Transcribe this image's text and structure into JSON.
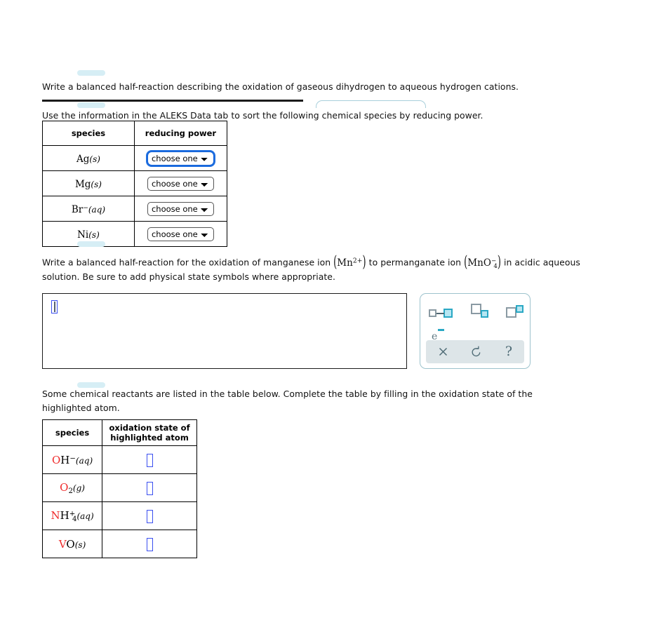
{
  "page": {
    "background": "#ffffff",
    "focus_ring_color": "#1f6fe0",
    "highlight_atom_color": "#ef2b2b",
    "input_box_color": "#3a4ff0",
    "palette_accent": "#2aa8c4"
  },
  "question_1": {
    "text": "Write a balanced half-reaction describing the oxidation of gaseous dihydrogen to aqueous hydrogen cations."
  },
  "question_2": {
    "text": "Use the information in the ALEKS Data tab to sort the following chemical species by reducing power.",
    "table": {
      "headers": [
        "species",
        "reducing power"
      ],
      "rows": [
        {
          "species": {
            "symbol": "Ag",
            "charge": "",
            "state": "(s)"
          },
          "select": {
            "value": "choose one",
            "options": [
              "choose one"
            ],
            "focused": true
          }
        },
        {
          "species": {
            "symbol": "Mg",
            "charge": "",
            "state": "(s)"
          },
          "select": {
            "value": "choose one",
            "options": [
              "choose one"
            ],
            "focused": false
          }
        },
        {
          "species": {
            "symbol": "Br",
            "charge": "−",
            "state": "(aq)"
          },
          "select": {
            "value": "choose one",
            "options": [
              "choose one"
            ],
            "focused": false
          }
        },
        {
          "species": {
            "symbol": "Ni",
            "charge": "",
            "state": "(s)"
          },
          "select": {
            "value": "choose one",
            "options": [
              "choose one"
            ],
            "focused": false
          }
        }
      ]
    }
  },
  "question_3": {
    "text_part_1": "Write a balanced half-reaction for the oxidation of manganese ion",
    "formula_1": {
      "base": "Mn",
      "sup": "2+"
    },
    "text_part_2": "to permanganate ion",
    "formula_2": {
      "base": "MnO",
      "sub": "4",
      "sup": "−"
    },
    "text_part_3": "in acidic aqueous",
    "text_line_2": "solution. Be sure to add physical state symbols where appropriate.",
    "answer_value": ""
  },
  "palette": {
    "buttons": [
      {
        "name": "reaction-arrow-button",
        "label": "□→□"
      },
      {
        "name": "subscript-button",
        "label": "□□"
      },
      {
        "name": "superscript-button",
        "label": "□□"
      },
      {
        "name": "electron-button",
        "label": "e−"
      }
    ],
    "footer": [
      {
        "name": "clear-button",
        "glyph": "×"
      },
      {
        "name": "undo-button",
        "glyph": "↺"
      },
      {
        "name": "help-button",
        "glyph": "?"
      }
    ]
  },
  "question_4": {
    "text": "Some chemical reactants are listed in the table below. Complete the table by filling in the oxidation state of the highlighted atom.",
    "table": {
      "headers": [
        "species",
        "oxidation state of highlighted atom"
      ],
      "rows": [
        {
          "highlighted": "O",
          "rest": "H",
          "sub": "",
          "sup": "−",
          "state": "(aq)",
          "value": ""
        },
        {
          "highlighted": "O",
          "rest": "",
          "sub": "2",
          "sup": "",
          "state": "(g)",
          "value": ""
        },
        {
          "highlighted": "N",
          "rest": "H",
          "sub": "4",
          "sup": "+",
          "state": "(aq)",
          "value": ""
        },
        {
          "highlighted": "V",
          "rest": "O",
          "sub": "",
          "sup": "",
          "state": "(s)",
          "value": ""
        }
      ]
    }
  }
}
